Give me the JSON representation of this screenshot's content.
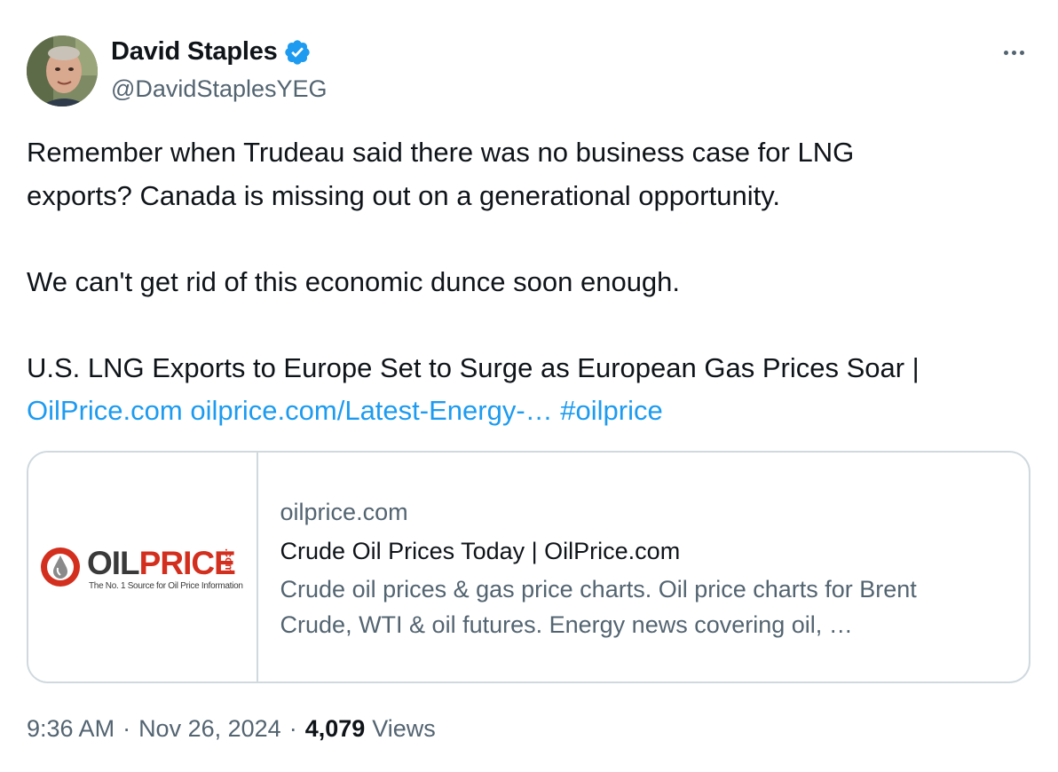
{
  "author": {
    "name": "David Staples",
    "handle": "@DavidStaplesYEG",
    "verified": true
  },
  "tweet": {
    "lines": [
      "Remember when Trudeau said there was no business case for LNG",
      "exports? Canada is missing out on a generational opportunity.",
      "",
      "We can't get rid of this economic dunce soon enough.",
      "",
      "U.S. LNG Exports to Europe Set to Surge as European Gas Prices Soar |"
    ],
    "links": {
      "mention": "OilPrice.com",
      "url": "oilprice.com/Latest-Energy-…",
      "hashtag": "#oilprice"
    }
  },
  "card": {
    "domain": "oilprice.com",
    "title": "Crude Oil Prices Today | OilPrice.com",
    "description_lines": [
      "Crude oil prices & gas price charts. Oil price charts for Brent",
      "Crude, WTI & oil futures. Energy news covering oil, …"
    ],
    "logo": {
      "word_1": "OIL",
      "word_2": "PRICE",
      "suffix": ".com",
      "tagline": "The No. 1 Source for Oil Price Information"
    }
  },
  "meta": {
    "time": "9:36 AM",
    "separator": "·",
    "date": "Nov 26, 2024",
    "views_count": "4,079",
    "views_label": "Views"
  },
  "colors": {
    "link": "#1d9bf0",
    "secondary_text": "#536471",
    "primary_text": "#0f1419",
    "border": "#cfd9de",
    "brand_red": "#d32f1e"
  },
  "icons": {
    "verified": "verified-badge-icon",
    "more": "more-options-icon",
    "logo_drop": "oil-drop-icon"
  }
}
